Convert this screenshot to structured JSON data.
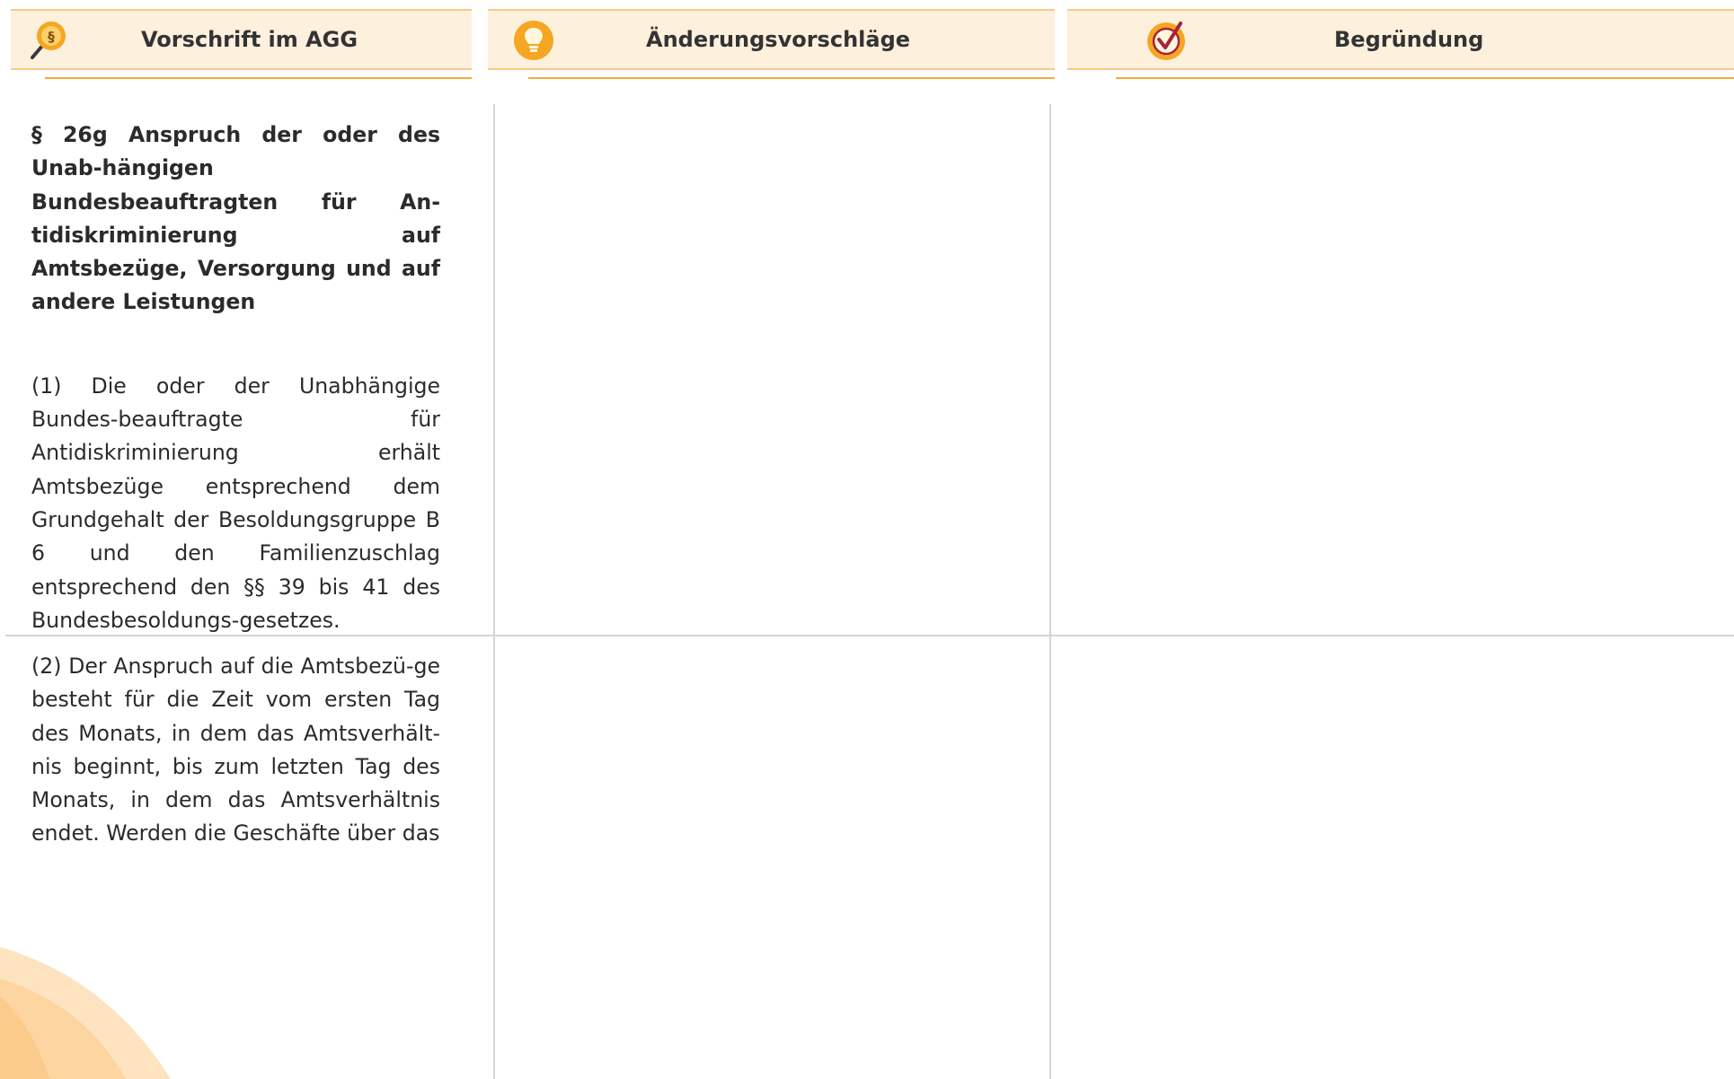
{
  "header": {
    "columns": [
      {
        "label": "Vorschrift im AGG",
        "icon": "magnifier-paragraph-icon"
      },
      {
        "label": "Änderungsvorschläge",
        "icon": "lightbulb-icon"
      },
      {
        "label": "Begründung",
        "icon": "checkmark-icon"
      }
    ]
  },
  "rows": [
    {
      "vorschrift": {
        "heading": "§ 26g Anspruch der oder des Unab-hängigen Bundesbeauftragten für An-tidiskriminierung auf Amtsbezüge, Versorgung und auf andere Leistungen",
        "text": "(1) Die oder der Unabhängige Bundes-beauftragte für Antidiskriminierung erhält Amtsbezüge entsprechend dem Grundgehalt der Besoldungsgruppe B 6 und den Familienzuschlag entsprechend den §§ 39 bis 41 des Bundesbesoldungs-gesetzes."
      },
      "aenderungsvorschlaege": "",
      "begruendung": ""
    },
    {
      "vorschrift": {
        "text": "(2) Der Anspruch auf die Amtsbezü-ge besteht für die Zeit vom ersten Tag des Monats, in dem das Amtsverhält-nis beginnt, bis zum letzten Tag des Monats, in dem das Amtsverhältnis endet. Werden die Geschäfte über das"
      },
      "aenderungsvorschlaege": "",
      "begruendung": ""
    }
  ],
  "colors": {
    "header_bg": "#fdf0dd",
    "header_border": "#f7c98a",
    "accent_orange": "#f4a93f",
    "grid_line": "#d4d4d4",
    "check_red": "#a8233a"
  }
}
